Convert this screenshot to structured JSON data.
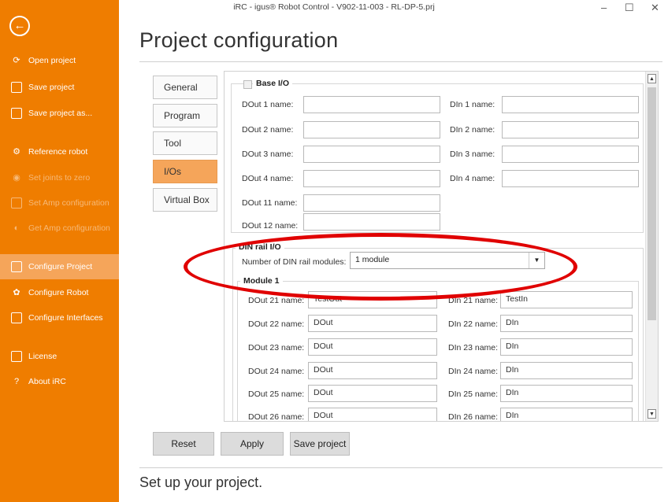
{
  "window": {
    "title": "iRC - igus® Robot Control - V902-11-003 - RL-DP-5.prj",
    "minimize": "–",
    "maximize": "☐",
    "close": "✕"
  },
  "sidebar": {
    "back": "←",
    "items": [
      {
        "label": "Open project",
        "icon": "open-project-icon"
      },
      {
        "label": "Save project",
        "icon": "save-icon"
      },
      {
        "label": "Save project as...",
        "icon": "save-as-icon"
      },
      {
        "label": "Reference robot",
        "icon": "reference-robot-icon"
      },
      {
        "label": "Set joints to zero",
        "icon": "set-zero-icon"
      },
      {
        "label": "Set Amp configuration",
        "icon": "amp-config-icon"
      },
      {
        "label": "Get Amp configuration",
        "icon": "get-amp-config-icon"
      },
      {
        "label": "Configure Project",
        "icon": "configure-project-icon"
      },
      {
        "label": "Configure Robot",
        "icon": "gear-icon"
      },
      {
        "label": "Configure Interfaces",
        "icon": "interfaces-icon"
      },
      {
        "label": "License",
        "icon": "license-icon"
      },
      {
        "label": "About iRC",
        "icon": "question-icon"
      }
    ]
  },
  "page": {
    "title": "Project configuration",
    "footer": "Set up your project."
  },
  "tabs": [
    "General",
    "Program",
    "Tool",
    "I/Os",
    "Virtual Box"
  ],
  "base_io": {
    "legend": "Base I/O",
    "dout": [
      {
        "label": "DOut 1 name:",
        "value": ""
      },
      {
        "label": "DOut 2 name:",
        "value": ""
      },
      {
        "label": "DOut 3 name:",
        "value": ""
      },
      {
        "label": "DOut 4 name:",
        "value": ""
      },
      {
        "label": "DOut 11 name:",
        "value": ""
      },
      {
        "label": "DOut 12 name:",
        "value": ""
      }
    ],
    "din": [
      {
        "label": "DIn 1 name:",
        "value": ""
      },
      {
        "label": "DIn 2 name:",
        "value": ""
      },
      {
        "label": "DIn 3 name:",
        "value": ""
      },
      {
        "label": "DIn 4 name:",
        "value": ""
      }
    ]
  },
  "din_rail": {
    "legend": "DIN rail I/O",
    "modules_label": "Number of DIN rail modules:",
    "modules_value": "1 module",
    "module_legend": "Module 1",
    "dout": [
      {
        "label": "DOut 21 name:",
        "value": "TestOut"
      },
      {
        "label": "DOut 22 name:",
        "value": "DOut"
      },
      {
        "label": "DOut 23 name:",
        "value": "DOut"
      },
      {
        "label": "DOut 24 name:",
        "value": "DOut"
      },
      {
        "label": "DOut 25 name:",
        "value": "DOut"
      },
      {
        "label": "DOut 26 name:",
        "value": "DOut"
      }
    ],
    "din": [
      {
        "label": "DIn 21 name:",
        "value": "TestIn"
      },
      {
        "label": "DIn 22 name:",
        "value": "DIn"
      },
      {
        "label": "DIn 23 name:",
        "value": "DIn"
      },
      {
        "label": "DIn 24 name:",
        "value": "DIn"
      },
      {
        "label": "DIn 25 name:",
        "value": "DIn"
      },
      {
        "label": "DIn 26 name:",
        "value": "DIn"
      }
    ]
  },
  "buttons": {
    "reset": "Reset",
    "apply": "Apply",
    "save": "Save project"
  },
  "colors": {
    "accent": "#ef7d00",
    "active": "#f5a55a",
    "annotation": "#e00000"
  }
}
